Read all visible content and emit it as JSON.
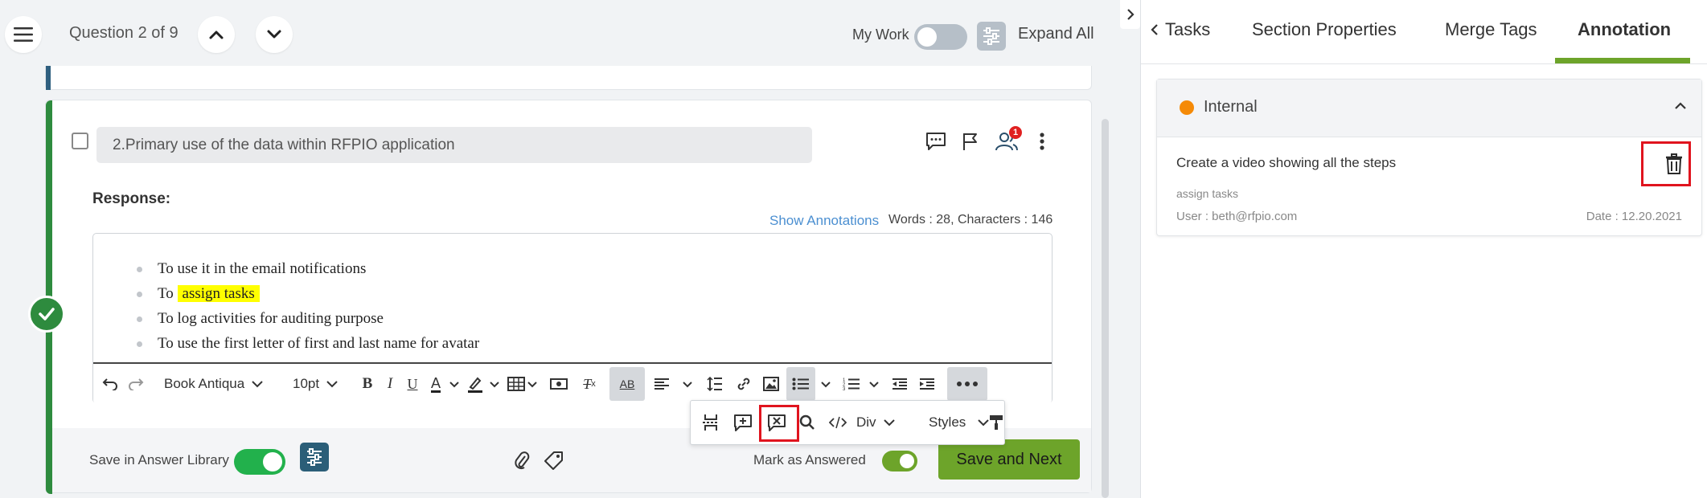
{
  "topbar": {
    "question_label": "Question 2 of 9",
    "my_work_label": "My Work",
    "expand_all_label": "Expand All"
  },
  "question": {
    "title": "2.Primary use of the data within RFPIO application",
    "assignee_badge": "1",
    "response_label": "Response:",
    "show_annotations_label": "Show Annotations",
    "word_count": "Words : 28, Characters : 146",
    "response_items": [
      {
        "prefix": "To use it in the email notifications",
        "highlight": ""
      },
      {
        "prefix": "To ",
        "highlight": "assign tasks"
      },
      {
        "prefix": "To log activities for auditing purpose",
        "highlight": ""
      },
      {
        "prefix": "To use the first letter of first and last name for avatar",
        "highlight": ""
      }
    ]
  },
  "toolbar": {
    "font_family": "Book Antiqua",
    "font_size": "10pt",
    "bold": "B",
    "italic": "I",
    "underline": "U",
    "font_color": "A",
    "clear_format": "T",
    "spellcheck": "AB"
  },
  "popup_toolbar": {
    "block_format": "Div",
    "styles_label": "Styles"
  },
  "footer": {
    "save_in_library_label": "Save in Answer Library",
    "mark_as_answered_label": "Mark as Answered",
    "save_next_label": "Save and Next"
  },
  "right_panel": {
    "tabs": [
      "Tasks",
      "Section Properties",
      "Merge Tags",
      "Annotation"
    ],
    "active_tab": "Annotation",
    "annotation": {
      "type": "Internal",
      "type_color": "#f58a07",
      "text": "Create a video showing all the steps",
      "quoted_text": "assign tasks",
      "user": "User : beth@rfpio.com",
      "date": "Date : 12.20.2021"
    }
  },
  "colors": {
    "accent_green": "#6da42a",
    "status_green": "#2e8b3e",
    "toggle_green": "#22b14c",
    "highlight_yellow": "#ffff00",
    "link_blue": "#4b8fd1",
    "callout_red": "#e0141e"
  }
}
